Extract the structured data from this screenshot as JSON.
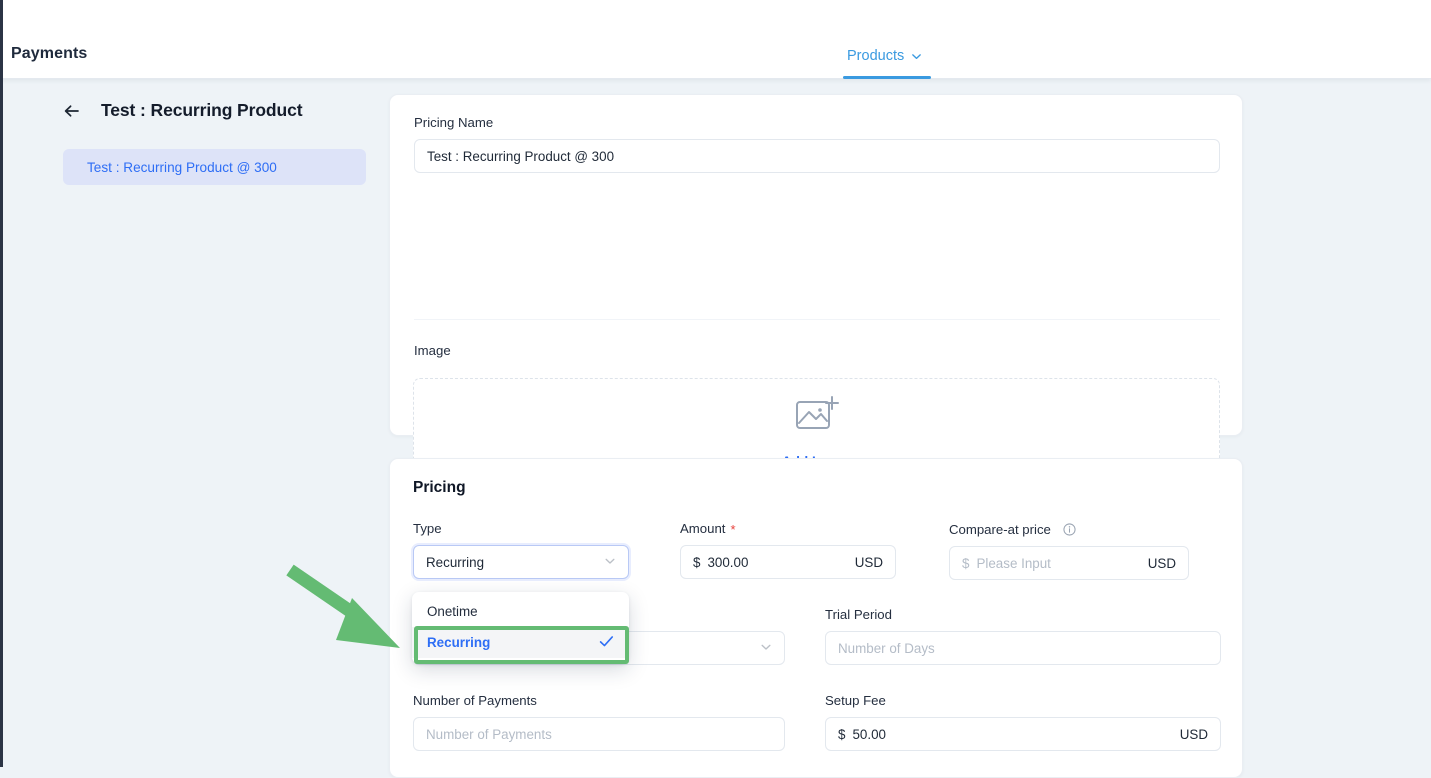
{
  "header": {
    "title": "Payments",
    "tab": {
      "label": "Products",
      "icon": "chevron-down-icon",
      "accent": "#3a9ae0",
      "active": true
    }
  },
  "sidebar": {
    "back_icon": "arrow-left-icon",
    "title": "Test : Recurring Product",
    "items": [
      {
        "label": "Test : Recurring Product @ 300",
        "selected": true
      }
    ]
  },
  "general_card": {
    "pricing_name": {
      "label": "Pricing Name",
      "value": "Test : Recurring Product @ 300",
      "placeholder": "Pricing Name"
    },
    "image": {
      "label": "Image",
      "dropzone_icon": "image-add-icon",
      "dropzone_label": "Add Image"
    }
  },
  "pricing_card": {
    "heading": "Pricing",
    "type": {
      "label": "Type",
      "value": "Recurring",
      "icon": "chevron-down-icon",
      "focused": true,
      "open": true,
      "options": [
        {
          "label": "Onetime",
          "selected": false
        },
        {
          "label": "Recurring",
          "selected": true,
          "check_icon": "check-icon"
        }
      ]
    },
    "amount": {
      "label": "Amount",
      "required": true,
      "required_marker": "*",
      "prefix": "$",
      "value": "300.00",
      "currency": "USD"
    },
    "compare_at_price": {
      "label": "Compare-at price",
      "info_icon": "info-circle-icon",
      "prefix": "$",
      "value": "",
      "placeholder": "Please Input",
      "currency": "USD"
    },
    "billing_period": {
      "label": "",
      "value": "",
      "placeholder": "",
      "icon": "chevron-down-icon"
    },
    "trial_period": {
      "label": "Trial Period",
      "value": "",
      "placeholder": "Number of Days"
    },
    "number_of_payments": {
      "label": "Number of Payments",
      "value": "",
      "placeholder": "Number of Payments"
    },
    "setup_fee": {
      "label": "Setup Fee",
      "prefix": "$",
      "value": "50.00",
      "currency": "USD"
    }
  },
  "annotations": {
    "highlight_color": "#64bb73",
    "arrow_color": "#64bb73",
    "highlight_target": "Recurring"
  }
}
